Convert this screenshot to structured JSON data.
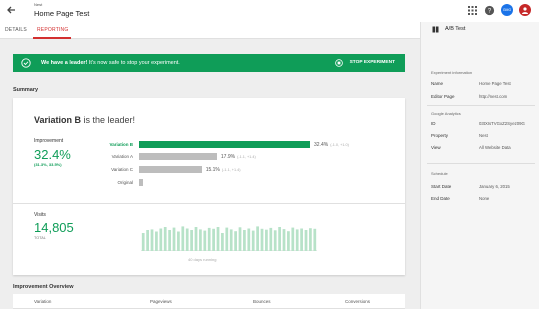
{
  "header": {
    "breadcrumb": "Nest",
    "title": "Home Page Test",
    "account_initials": "GMG"
  },
  "tabs": [
    {
      "label": "DETAILS",
      "active": false
    },
    {
      "label": "REPORTING",
      "active": true
    }
  ],
  "banner": {
    "message_bold": "We have a leader!",
    "message_rest": " It's now safe to stop your experiment.",
    "stop_label": "STOP EXPERIMENT",
    "color": "#0f9d58"
  },
  "summary": {
    "heading": "Summary",
    "leader_name": "Variation B",
    "leader_suffix": " is the leader!",
    "improvement_label": "Improvement",
    "improvement_value": "32.4%",
    "improvement_range": "(31.3%, 33.5%)",
    "variations": [
      {
        "name": "Variation B",
        "pct": "32.4%",
        "range": "(-1.0, +1.0)",
        "lead": true,
        "fraction": 0.9
      },
      {
        "name": "Variation A",
        "pct": "17.9%",
        "range": "(-1.1, +1.4)",
        "lead": false,
        "fraction": 0.41
      },
      {
        "name": "Variation C",
        "pct": "15.1%",
        "range": "(-1.1, +1.4)",
        "lead": false,
        "fraction": 0.33
      },
      {
        "name": "Original",
        "pct": "",
        "range": "",
        "lead": false,
        "fraction": 0.02
      }
    ],
    "visits_label": "Visits",
    "visits_value": "14,805",
    "visits_total": "TOTAL",
    "days_running": "40 days running",
    "visits_series": [
      0.6,
      0.7,
      0.72,
      0.65,
      0.75,
      0.8,
      0.7,
      0.78,
      0.65,
      0.82,
      0.75,
      0.7,
      0.8,
      0.72,
      0.68,
      0.77,
      0.74,
      0.8,
      0.6,
      0.78,
      0.72,
      0.66,
      0.79,
      0.7,
      0.75,
      0.68,
      0.82,
      0.74,
      0.71,
      0.77,
      0.69,
      0.8,
      0.73,
      0.66,
      0.78,
      0.72,
      0.75,
      0.7,
      0.76,
      0.74
    ]
  },
  "overview": {
    "heading": "Improvement Overview",
    "columns": [
      "Variation",
      "Pageviews",
      "Bounces",
      "Conversions"
    ]
  },
  "sidebar": {
    "title": "A/B Test",
    "sections": [
      {
        "heading": "Experiment information",
        "rows": [
          {
            "k": "Name",
            "v": "Home Page Test"
          },
          {
            "k": "Editor Page",
            "v": "http://nest.com"
          }
        ]
      },
      {
        "heading": "Google Analytics",
        "rows": [
          {
            "k": "ID",
            "v": "03tXIsTVGxZ2Syez09G"
          },
          {
            "k": "Property",
            "v": "Nest"
          },
          {
            "k": "View",
            "v": "All Website Data"
          }
        ]
      },
      {
        "heading": "Schedule",
        "rows": [
          {
            "k": "Start Date",
            "v": "January 6, 2015"
          },
          {
            "k": "End Date",
            "v": "None"
          }
        ]
      }
    ]
  },
  "colors": {
    "accent": "#d32f2f",
    "success": "#0f9d58",
    "neutral_bar": "#bdbdbd"
  }
}
